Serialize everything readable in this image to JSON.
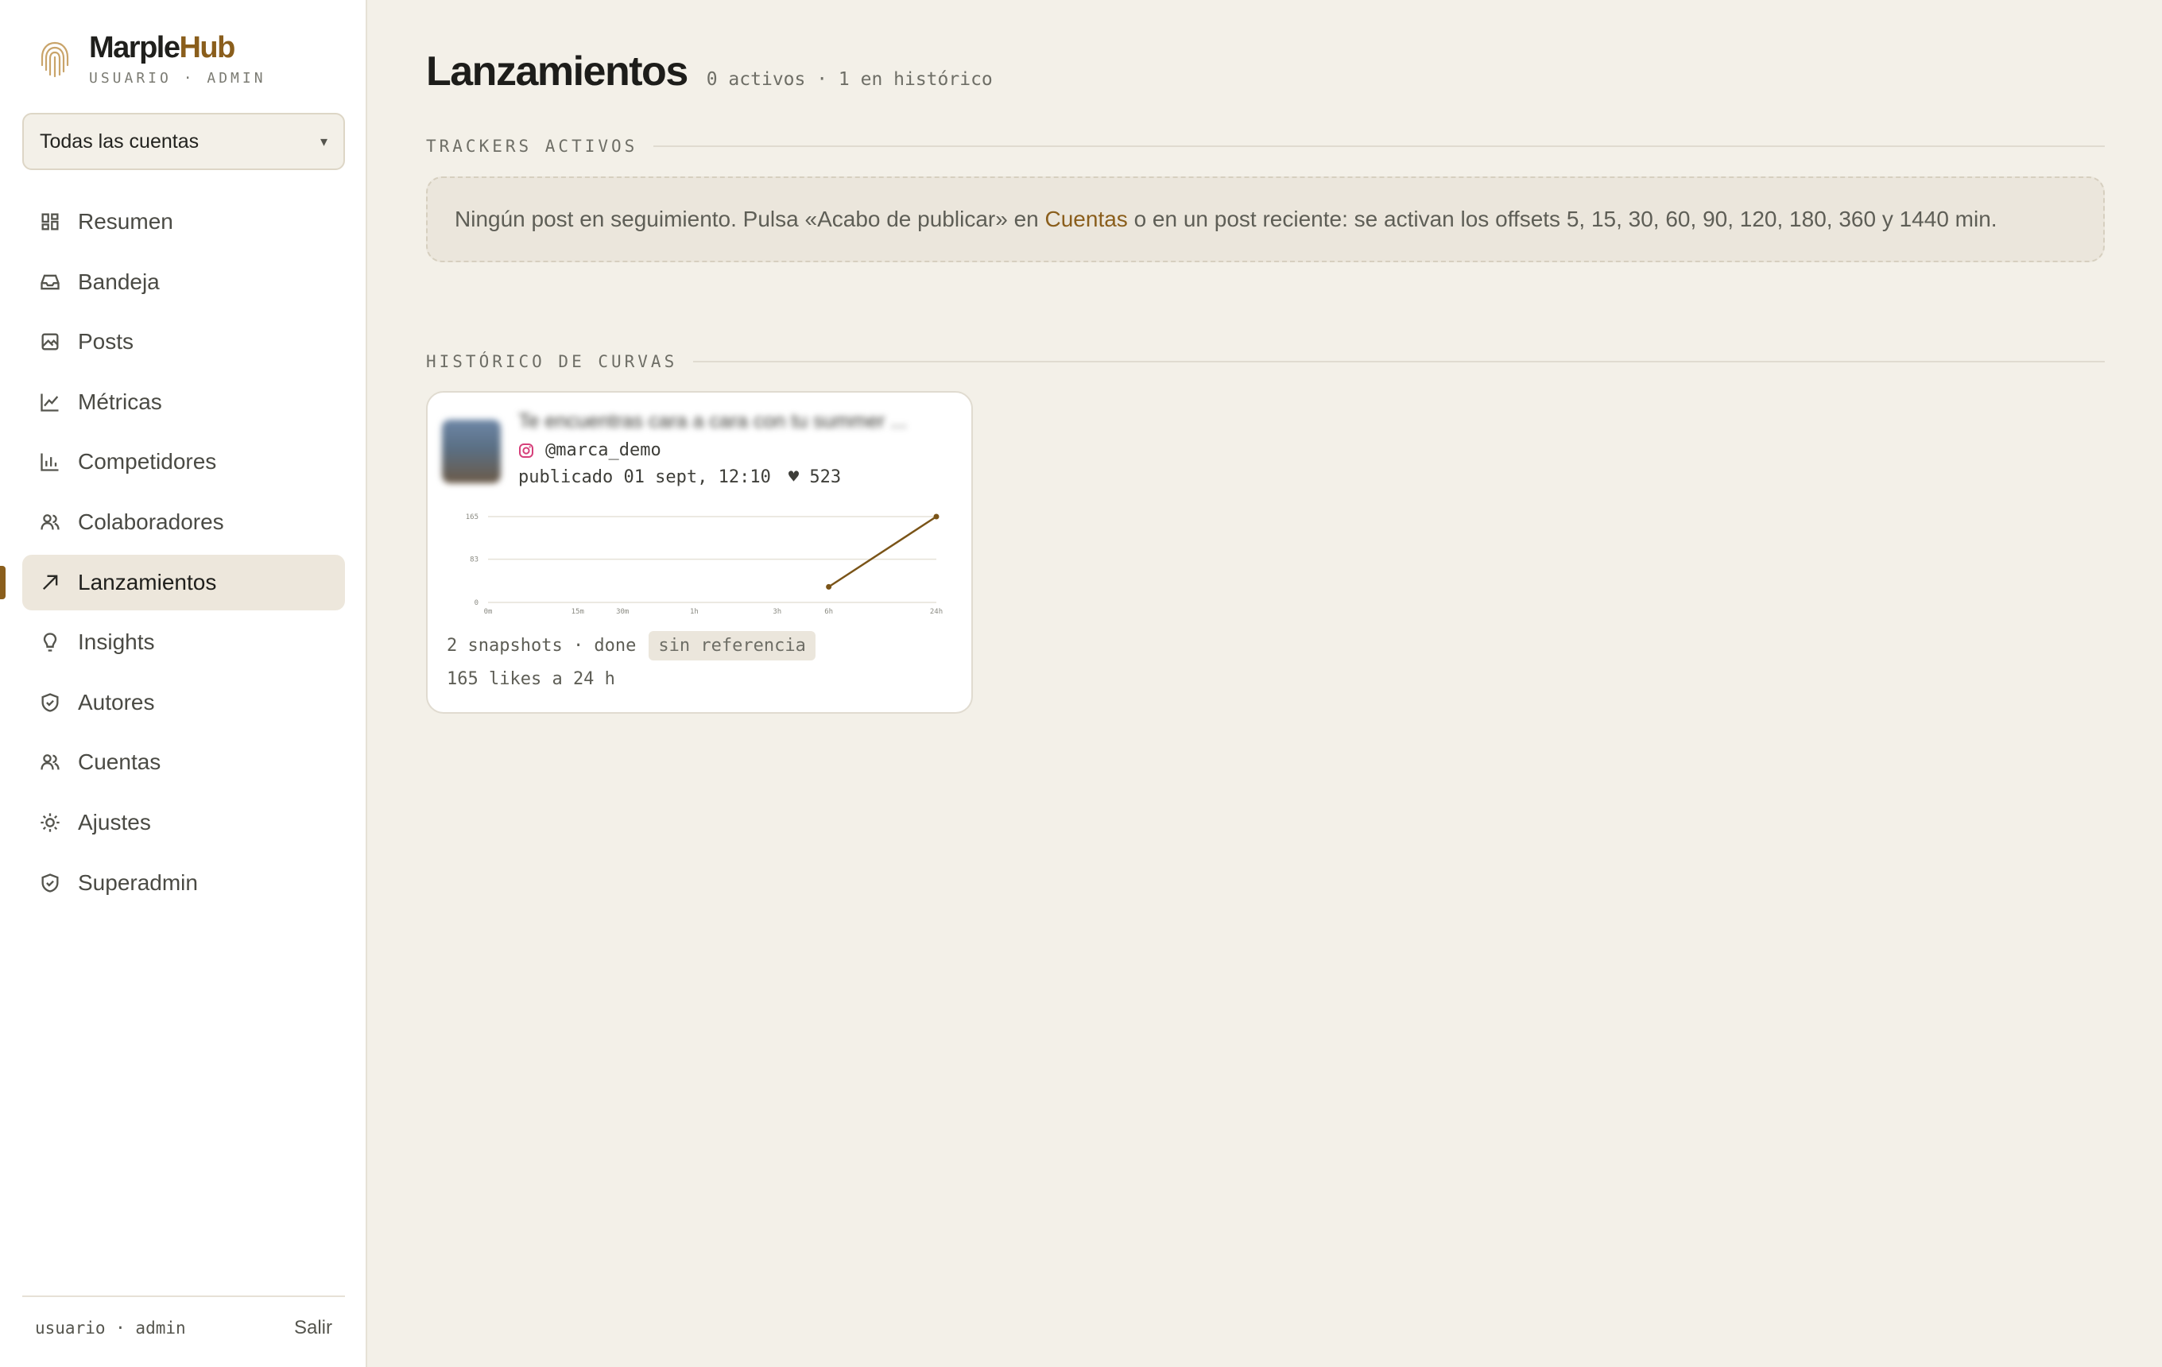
{
  "brand": {
    "name_part1": "Marple",
    "name_part2": "Hub",
    "subtitle": "USUARIO · ADMIN"
  },
  "account_selector": {
    "value": "Todas las cuentas",
    "caret": "▾"
  },
  "sidebar": {
    "items": [
      {
        "label": "Resumen",
        "icon": "dashboard-icon"
      },
      {
        "label": "Bandeja",
        "icon": "inbox-icon"
      },
      {
        "label": "Posts",
        "icon": "image-icon"
      },
      {
        "label": "Métricas",
        "icon": "line-chart-icon"
      },
      {
        "label": "Competidores",
        "icon": "bar-chart-icon"
      },
      {
        "label": "Colaboradores",
        "icon": "users-icon"
      },
      {
        "label": "Lanzamientos",
        "icon": "arrow-up-right-icon",
        "active": true
      },
      {
        "label": "Insights",
        "icon": "lightbulb-icon"
      },
      {
        "label": "Autores",
        "icon": "shield-check-icon"
      },
      {
        "label": "Cuentas",
        "icon": "users-icon"
      },
      {
        "label": "Ajustes",
        "icon": "sun-icon"
      },
      {
        "label": "Superadmin",
        "icon": "shield-check-icon"
      }
    ],
    "footer": {
      "user": "usuario · admin",
      "logout": "Salir"
    }
  },
  "page": {
    "title": "Lanzamientos",
    "meta": "0 activos · 1 en histórico"
  },
  "active_trackers": {
    "title": "TRACKERS ACTIVOS",
    "empty_text_before": "Ningún post en seguimiento. Pulsa «Acabo de publicar» en ",
    "empty_link": "Cuentas",
    "empty_text_after": " o en un post reciente: se activan los offsets 5, 15, 30, 60, 90, 120, 180, 360 y 1440 min."
  },
  "history": {
    "title": "HISTÓRICO DE CURVAS",
    "card": {
      "caption": "Te encuentras cara a cara con tu summer ...",
      "handle": "@marca_demo",
      "published": "publicado 01 sept, 12:10",
      "likes": "♥ 523",
      "snapshots": "2 snapshots · done",
      "badge": "sin referencia",
      "summary": "165 likes a 24 h"
    }
  },
  "chart_data": {
    "type": "line",
    "x_ticks": [
      "0m",
      "15m",
      "30m",
      "1h",
      "3h",
      "6h",
      "24h"
    ],
    "y_ticks": [
      "165",
      "83",
      "0"
    ],
    "ylim": [
      0,
      165
    ],
    "series": [
      {
        "points": [
          {
            "x": "6h",
            "y": 30
          },
          {
            "x": "24h",
            "y": 165
          }
        ]
      }
    ],
    "colors": {
      "line": "#7a5418",
      "grid": "#e6e2d8",
      "tick": "#8a8a82"
    }
  },
  "colors": {
    "accent": "#8a5e1c",
    "background": "#f3f0e8",
    "sidebar": "#ffffff"
  }
}
